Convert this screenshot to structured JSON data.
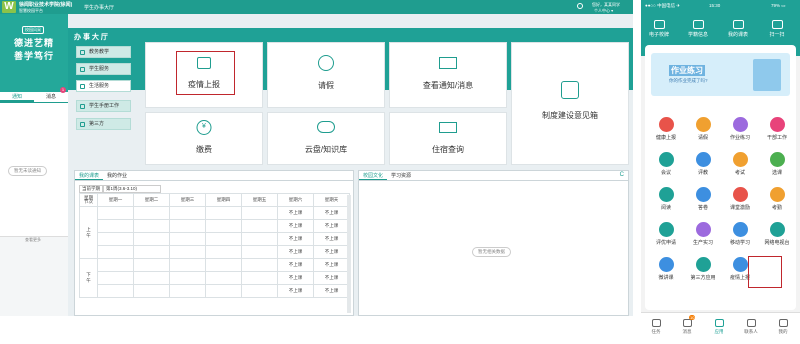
{
  "desktop": {
    "topbar": {
      "school": "徐闻职业技术学院(徐闻)",
      "subtitle": "智慧校园平台",
      "section": "学生办事大厅",
      "user": "您好，某某同学",
      "user_sub": "个人中心 ▾"
    },
    "sidebar": {
      "tag": "校园风采",
      "slogan1": "德进艺精",
      "slogan2": "善学笃行",
      "tab_notice": "通知",
      "tab_message": "消息",
      "message_badge": "1",
      "empty": "暂无未读通知",
      "more": "查看更多"
    },
    "section_title": "办 事 大 厅",
    "nav": [
      "教务教学",
      "学生服务",
      "生活服务",
      "学生手册工作",
      "第三方"
    ],
    "tiles": [
      "疫情上报",
      "请假",
      "查看通知/消息",
      "制度建设意见箱",
      "缴费",
      "云盘/知识库",
      "住宿查询"
    ],
    "schedule": {
      "tab1": "我的课表",
      "tab2": "我的作业",
      "term": "当前学期",
      "week": "第1周(3.6-3.10)",
      "headers": [
        "星期\n节次",
        "星期一",
        "星期二",
        "星期三",
        "星期四",
        "星期五",
        "星期六",
        "星期天"
      ],
      "morning": "上\n午",
      "afternoon": "下\n午",
      "no_class": "不上课"
    },
    "news": {
      "tab1": "校园文化",
      "tab2": "学习资源",
      "empty": "暂无相关数据",
      "refresh": "C"
    }
  },
  "phone": {
    "status": {
      "carrier": "●●○○ 中国电信 ✈",
      "time": "15:30",
      "battery": "79% ▭"
    },
    "quick": [
      "电子校牌",
      "学籍信息",
      "我的课表",
      "扫一扫"
    ],
    "banner": {
      "title": "作业练习",
      "sub": "你的作业完成了吗?"
    },
    "apps": [
      "健康上报",
      "请假",
      "作业练习",
      "干部工作",
      "会议",
      "评教",
      "考试",
      "选课",
      "阅读",
      "答卷",
      "课堂激励",
      "考勤",
      "评优申请",
      "生产实习",
      "移动学习",
      "网络电视台",
      "微讲课",
      "第三方应用",
      "疫情上报"
    ],
    "bottom_nav": [
      "任务",
      "消息",
      "应用",
      "联系人",
      "我的"
    ],
    "msg_badge": "10",
    "colors": {
      "primary": "#1fa196",
      "highlight": "#c0272d"
    }
  }
}
